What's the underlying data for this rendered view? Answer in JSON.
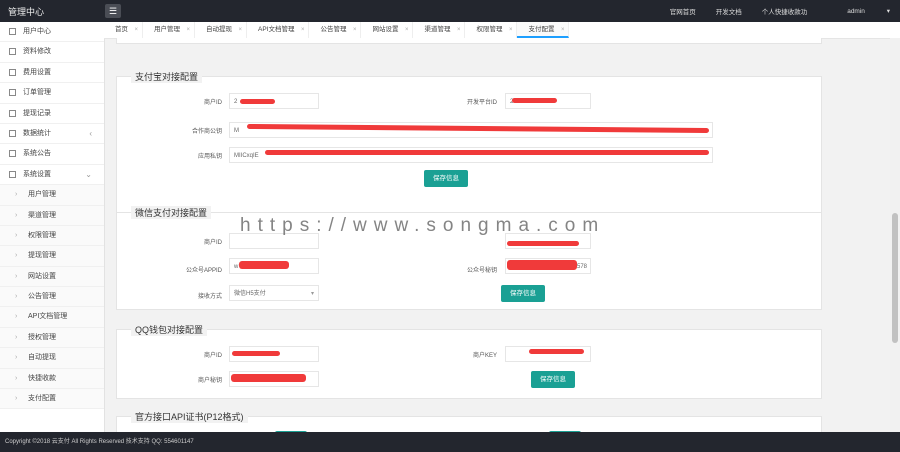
{
  "header": {
    "brand": "管理中心",
    "menu_icon": "☰",
    "links": [
      "官网首页",
      "开发文档",
      "个人快捷收款功"
    ],
    "user": "admin"
  },
  "sidebar": {
    "items": [
      {
        "label": "用户中心"
      },
      {
        "label": "资料修改"
      },
      {
        "label": "费用设置"
      },
      {
        "label": "订单管理"
      },
      {
        "label": "提现记录"
      },
      {
        "label": "数据统计",
        "chevron": "‹"
      },
      {
        "label": "系统公告"
      },
      {
        "label": "系统设置",
        "chevron": "⌄"
      }
    ],
    "children": [
      {
        "label": "用户管理"
      },
      {
        "label": "渠道管理"
      },
      {
        "label": "权限管理"
      },
      {
        "label": "提现管理"
      },
      {
        "label": "网站设置"
      },
      {
        "label": "公告管理"
      },
      {
        "label": "API文档管理"
      },
      {
        "label": "授权管理"
      },
      {
        "label": "自动提现"
      },
      {
        "label": "快捷收款"
      },
      {
        "label": "支付配置"
      }
    ]
  },
  "tabs": [
    {
      "label": "首页"
    },
    {
      "label": "用户管理"
    },
    {
      "label": "自动提现"
    },
    {
      "label": "API文档管理"
    },
    {
      "label": "公告管理"
    },
    {
      "label": "网站设置"
    },
    {
      "label": "渠道管理"
    },
    {
      "label": "权限管理"
    },
    {
      "label": "支付配置"
    }
  ],
  "tab_close": "×",
  "alipay": {
    "title": "支付宝对接配置",
    "merchant_label": "商户ID",
    "merchant_value": "2",
    "open_label": "开发平台ID",
    "open_value": "2",
    "key_label": "合作商公钥",
    "key_value": "M",
    "private_label": "应用私钥",
    "private_value": "MIICxqIE",
    "save": "保存信息"
  },
  "wechat": {
    "title": "微信支付对接配置",
    "merchant_label": "商户ID",
    "appid_label": "公众号APPID",
    "appid_value": "w",
    "secret_label": "公众号秘钥",
    "secret_value": "R578",
    "mode_label": "接收方式",
    "mode_value": "微信H5支付",
    "save": "保存信息"
  },
  "qq": {
    "title": "QQ钱包对接配置",
    "merchant_label": "商户ID",
    "key_label": "商户KEY",
    "secret_label": "商户秘钥",
    "save": "保存信息"
  },
  "cert": {
    "title": "官方接口API证书(P12格式)"
  },
  "watermark": "https://www.songma.com",
  "footer": "Copyright ©2018 云支付 All Rights Reserved   技术支持 QQ: 554601147"
}
